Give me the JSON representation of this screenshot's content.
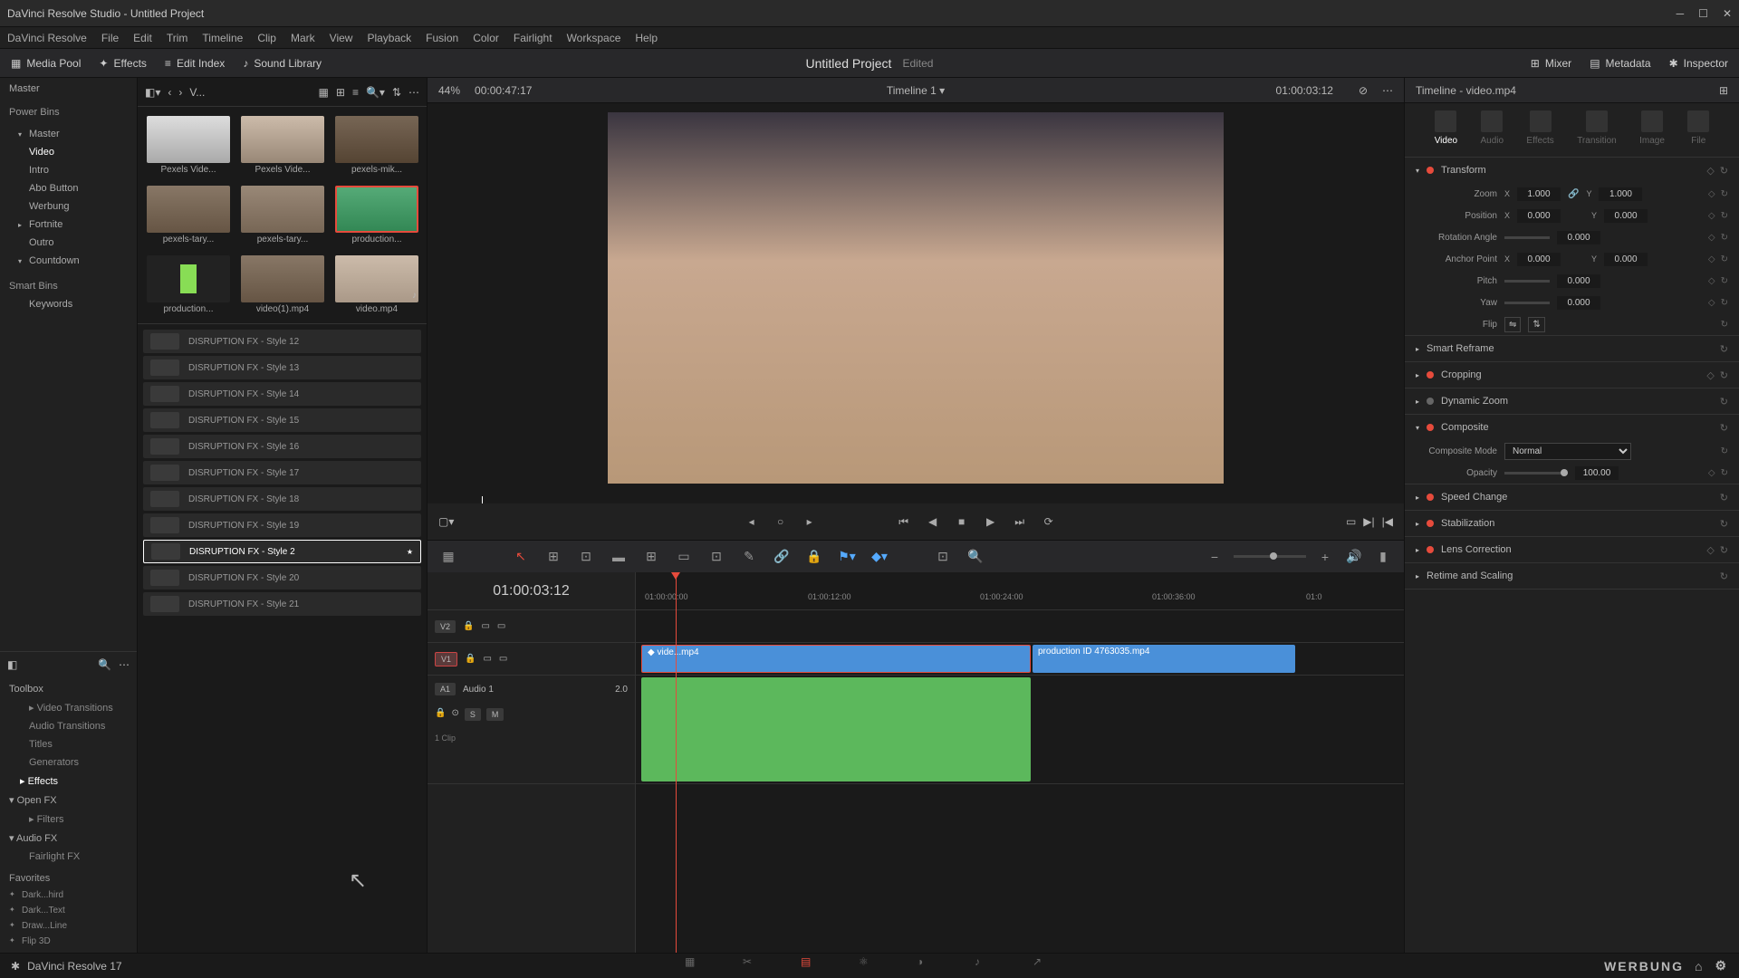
{
  "titlebar": {
    "title": "DaVinci Resolve Studio - Untitled Project"
  },
  "menu": [
    "DaVinci Resolve",
    "File",
    "Edit",
    "Trim",
    "Timeline",
    "Clip",
    "Mark",
    "View",
    "Playback",
    "Fusion",
    "Color",
    "Fairlight",
    "Workspace",
    "Help"
  ],
  "toolbar": {
    "media_pool": "Media Pool",
    "effects": "Effects",
    "edit_index": "Edit Index",
    "sound_library": "Sound Library",
    "mixer": "Mixer",
    "metadata": "Metadata",
    "inspector": "Inspector",
    "project": "Untitled Project",
    "edited": "Edited"
  },
  "viewer_header": {
    "zoom": "44%",
    "tc_left": "00:00:47:17",
    "timeline_name": "Timeline 1",
    "tc_right": "01:00:03:12"
  },
  "media_pool": {
    "master": "Master",
    "power_bins": "Power Bins",
    "smart_bins": "Smart Bins",
    "bins": [
      "Master",
      "Video",
      "Intro",
      "Abo Button",
      "Werbung",
      "Fortnite",
      "Outro",
      "Countdown"
    ],
    "smart": [
      "Keywords"
    ],
    "sort": "V...",
    "clips": [
      "Pexels Vide...",
      "Pexels Vide...",
      "pexels-mik...",
      "pexels-tary...",
      "pexels-tary...",
      "production...",
      "production...",
      "video(1).mp4",
      "video.mp4"
    ]
  },
  "effects_tree": {
    "toolbox": "Toolbox",
    "cats": [
      "Video Transitions",
      "Audio Transitions",
      "Titles",
      "Generators",
      "Effects"
    ],
    "openfx": "Open FX",
    "filters": "Filters",
    "audiofx": "Audio FX",
    "fairlight": "Fairlight FX",
    "favorites": "Favorites",
    "favs": [
      "Dark...hird",
      "Dark...Text",
      "Draw...Line",
      "Flip 3D"
    ]
  },
  "effects_list": [
    "DISRUPTION FX - Style 12",
    "DISRUPTION FX - Style 13",
    "DISRUPTION FX - Style 14",
    "DISRUPTION FX - Style 15",
    "DISRUPTION FX - Style 16",
    "DISRUPTION FX - Style 17",
    "DISRUPTION FX - Style 18",
    "DISRUPTION FX - Style 19",
    "DISRUPTION FX - Style 2",
    "DISRUPTION FX - Style 20",
    "DISRUPTION FX - Style 21"
  ],
  "timeline": {
    "tc": "01:00:03:12",
    "marks": [
      "01:00:00:00",
      "01:00:12:00",
      "01:00:24:00",
      "01:00:36:00",
      "01:0"
    ],
    "v2": "V2",
    "v1": "V1",
    "a1": "A1",
    "audio1": "Audio 1",
    "audio_ch": "2.0",
    "clip_info": "1 Clip",
    "clip1": "vide...mp4",
    "clip2": "production ID 4763035.mp4"
  },
  "inspector": {
    "title": "Timeline - video.mp4",
    "tabs": [
      "Video",
      "Audio",
      "Effects",
      "Transition",
      "Image",
      "File"
    ],
    "transform": {
      "label": "Transform",
      "zoom": "Zoom",
      "zoom_x": "1.000",
      "zoom_y": "1.000",
      "position": "Position",
      "pos_x": "0.000",
      "pos_y": "0.000",
      "rotation": "Rotation Angle",
      "rot_val": "0.000",
      "anchor": "Anchor Point",
      "anch_x": "0.000",
      "anch_y": "0.000",
      "pitch": "Pitch",
      "pitch_val": "0.000",
      "yaw": "Yaw",
      "yaw_val": "0.000",
      "flip": "Flip"
    },
    "sections": [
      "Smart Reframe",
      "Cropping",
      "Dynamic Zoom",
      "Composite",
      "Speed Change",
      "Stabilization",
      "Lens Correction",
      "Retime and Scaling"
    ],
    "composite_mode": "Composite Mode",
    "composite_val": "Normal",
    "opacity": "Opacity",
    "opacity_val": "100.00"
  },
  "status": {
    "app": "DaVinci Resolve 17",
    "brand": "WERBUNG"
  }
}
